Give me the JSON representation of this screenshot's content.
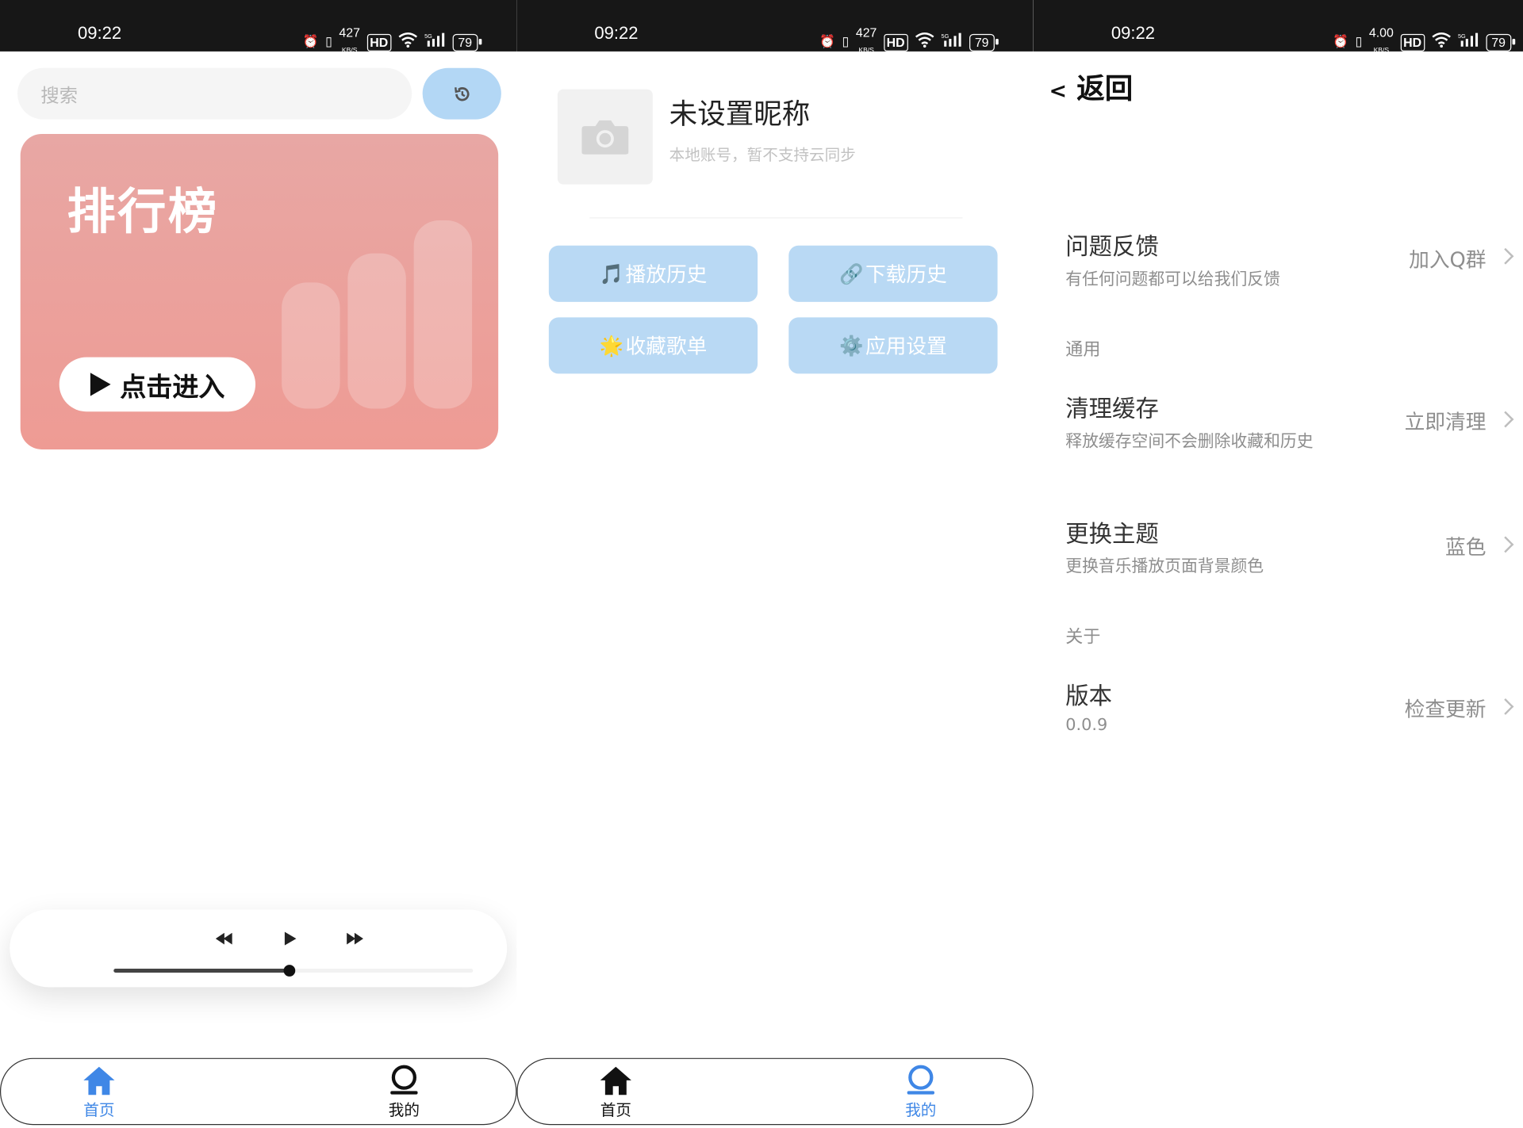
{
  "status_bar": {
    "time": "09:22",
    "net_speed_1": "427",
    "net_speed_2": "427",
    "net_speed_3": "4.00",
    "net_unit": "KB/S",
    "hd": "HD",
    "signal": "5G",
    "battery": "79"
  },
  "home": {
    "search_placeholder": "搜索",
    "rank_title": "排行榜",
    "enter_label": "点击进入",
    "progress": 0.49
  },
  "nav": {
    "home_label": "首页",
    "mine_label": "我的",
    "active_color": "#3f87e6",
    "inactive_color": "#111111"
  },
  "mine": {
    "nickname": "未设置昵称",
    "account_note": "本地账号，暂不支持云同步",
    "buttons": [
      {
        "icon": "🎵",
        "label": "播放历史"
      },
      {
        "icon": "🔗",
        "label": "下载历史"
      },
      {
        "icon": "🌟",
        "label": "收藏歌单"
      },
      {
        "icon": "⚙️",
        "label": "应用设置"
      }
    ]
  },
  "settings": {
    "back_label": "返回",
    "feedback": {
      "title": "问题反馈",
      "subtitle": "有任何问题都可以给我们反馈",
      "action": "加入Q群"
    },
    "section_general": "通用",
    "cache": {
      "title": "清理缓存",
      "subtitle": "释放缓存空间不会删除收藏和历史",
      "action": "立即清理"
    },
    "theme": {
      "title": "更换主题",
      "subtitle": "更换音乐播放页面背景颜色",
      "action": "蓝色"
    },
    "section_about": "关于",
    "version": {
      "title": "版本",
      "subtitle": "0.0.9",
      "action": "检查更新"
    }
  }
}
